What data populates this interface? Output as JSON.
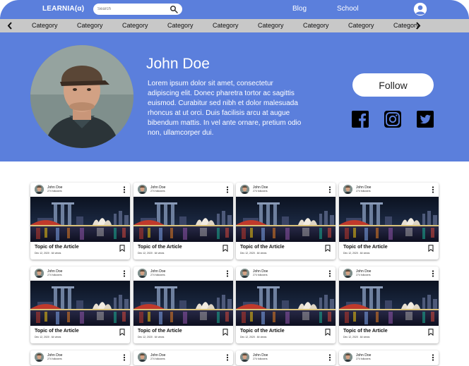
{
  "nav": {
    "brand": "LEARNIA(α)",
    "search_placeholder": "Search",
    "links": [
      "Blog",
      "School"
    ],
    "icons": {
      "search": "search-icon",
      "user": "user-circle-icon"
    }
  },
  "categories": [
    "Category",
    "Category",
    "Category",
    "Category",
    "Category",
    "Category",
    "Category",
    "Category",
    "Category"
  ],
  "profile": {
    "name": "John Doe",
    "bio": "Lorem ipsum dolor sit amet, consectetur adipiscing elit. Donec pharetra tortor ac sagittis euismod. Curabitur sed nibh et dolor malesuada rhoncus at ut orci. Duis facilisis arcu at augue bibendum mattis. In vel ante ornare, pretium odio non, ullamcorper dui.",
    "follow_label": "Follow",
    "social": [
      "facebook-icon",
      "instagram-icon",
      "twitter-icon"
    ]
  },
  "cards": [
    {
      "author": "John Doe",
      "followers": "274 followers",
      "title": "Topic of the Article",
      "meta": "Dec 12, 2020 . 64 views"
    },
    {
      "author": "John Doe",
      "followers": "274 followers",
      "title": "Topic of the Article",
      "meta": "Dec 12, 2020 . 64 views"
    },
    {
      "author": "John Doe",
      "followers": "274 followers",
      "title": "Topic of the Article",
      "meta": "Dec 12, 2020 . 64 views"
    },
    {
      "author": "John Doe",
      "followers": "274 followers",
      "title": "Topic of the Article",
      "meta": "Dec 12, 2020 . 64 views"
    },
    {
      "author": "John Doe",
      "followers": "274 followers",
      "title": "Topic of the Article",
      "meta": "Dec 12, 2020 . 64 views"
    },
    {
      "author": "John Doe",
      "followers": "274 followers",
      "title": "Topic of the Article",
      "meta": "Dec 12, 2020 . 64 views"
    },
    {
      "author": "John Doe",
      "followers": "274 followers",
      "title": "Topic of the Article",
      "meta": "Dec 12, 2020 . 64 views"
    },
    {
      "author": "John Doe",
      "followers": "274 followers",
      "title": "Topic of the Article",
      "meta": "Dec 12, 2020 . 64 views"
    },
    {
      "author": "John Doe",
      "followers": "274 followers",
      "title": "",
      "meta": ""
    },
    {
      "author": "John Doe",
      "followers": "274 followers",
      "title": "",
      "meta": ""
    },
    {
      "author": "John Doe",
      "followers": "274 followers",
      "title": "",
      "meta": ""
    },
    {
      "author": "John Doe",
      "followers": "274 followers",
      "title": "",
      "meta": ""
    }
  ],
  "colors": {
    "primary": "#5b7fdc",
    "category_bar": "#c8c8c8",
    "background": "#ffffff"
  }
}
